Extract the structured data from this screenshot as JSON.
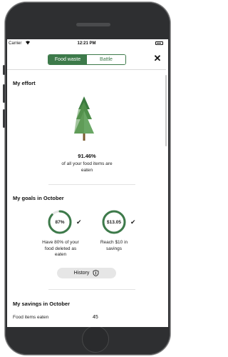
{
  "statusbar": {
    "carrier": "Carrier",
    "wifi_icon": "wifi-icon",
    "time": "12:21 PM",
    "battery_icon": "battery-icon"
  },
  "navbar": {
    "segments": [
      "Food waste",
      "Battle"
    ],
    "selected_segment": "Food waste",
    "close_label": "✕"
  },
  "effort": {
    "title": "My effort",
    "tree_icon": "tree-icon",
    "percentage": "91.46%",
    "description": "of all your food items are eaten"
  },
  "goals": {
    "title": "My goals in October",
    "items": [
      {
        "value": "87%",
        "progress": 0.87,
        "check": "✔",
        "description": "Have 80% of your food deleted as eaten"
      },
      {
        "value": "$13.05",
        "progress": 1.0,
        "check": "✔",
        "description": "Reach $10 in savings"
      }
    ],
    "history_label": "History",
    "history_icon": "shield-icon"
  },
  "savings": {
    "title": "My savings in October",
    "rows": [
      {
        "label": "Food items eaten",
        "value": "45"
      }
    ]
  },
  "colors": {
    "accent": "#3d7a4a",
    "ring_track": "#e6e6e6",
    "tree_light": "#6aa765",
    "tree_dark": "#3b7a3f"
  }
}
